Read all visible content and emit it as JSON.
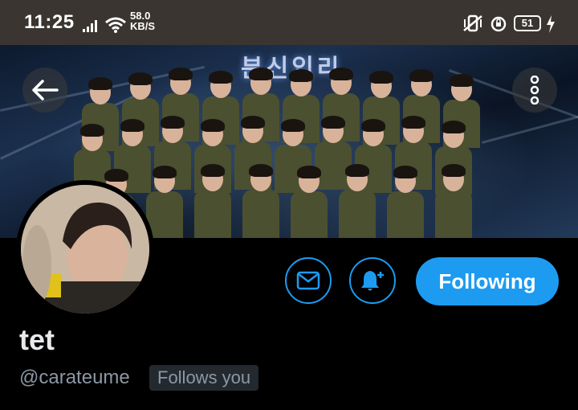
{
  "status_bar": {
    "time": "11:25",
    "net_speed_value": "58.0",
    "net_speed_unit": "KB/S",
    "battery_level": "51",
    "icons": [
      "signal-icon",
      "wifi-icon",
      "vibrate-off-icon",
      "alarm-icon",
      "battery-icon",
      "charging-icon"
    ]
  },
  "banner": {
    "stage_text": "분신입리"
  },
  "profile": {
    "display_name": "tet",
    "handle": "@carateume",
    "follows_you_label": "Follows you",
    "following_label": "Following"
  },
  "colors": {
    "accent": "#1d9bf0",
    "background": "#000000",
    "status_bar": "#3a3530",
    "secondary_text": "#8b98a5"
  }
}
